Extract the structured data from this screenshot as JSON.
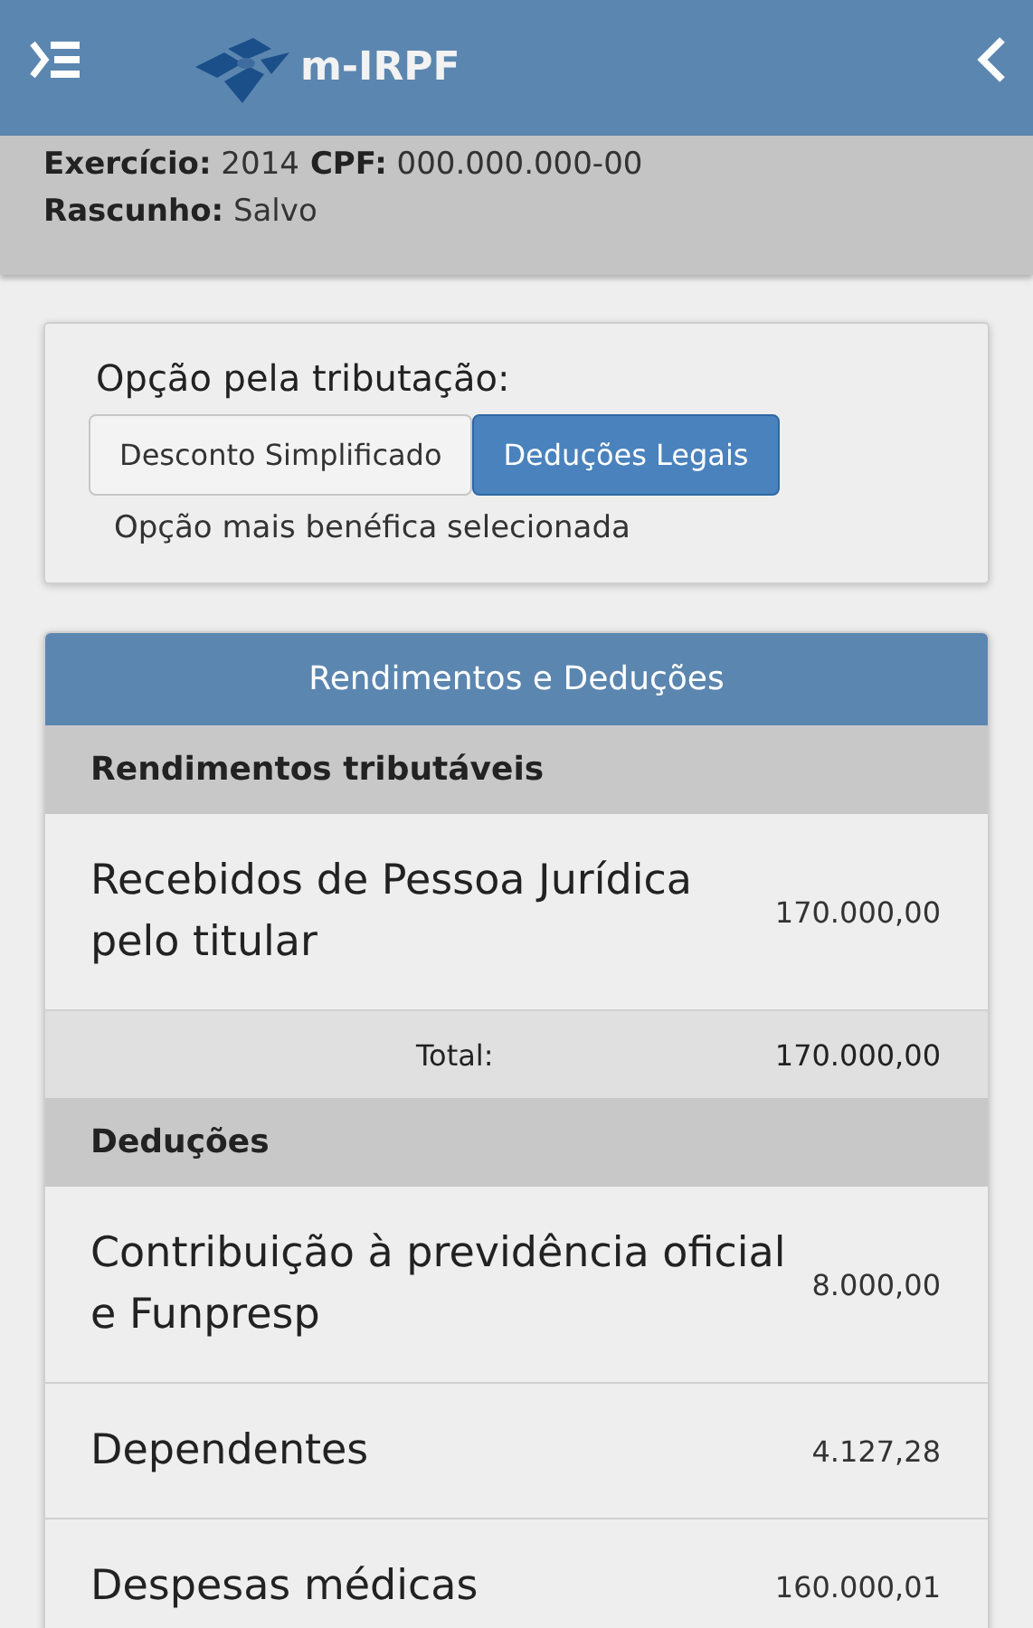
{
  "header": {
    "title": "m-IRPF"
  },
  "info_lines": [
    [
      {
        "label": "Exercício:",
        "value": "2014"
      },
      {
        "label": "CPF:",
        "value": "000.000.000-00"
      }
    ],
    [
      {
        "label": "Rascunho:",
        "value": "Salvo"
      }
    ]
  ],
  "options": {
    "title": "Opção pela tributação:",
    "buttons": [
      {
        "label": "Desconto Simplificado",
        "selected": false
      },
      {
        "label": "Deduções Legais",
        "selected": true
      }
    ],
    "note": "Opção mais benéfica selecionada"
  },
  "table": {
    "title": "Rendimentos e Deduções",
    "sections": [
      {
        "title": "Rendimentos tributáveis",
        "rows": [
          {
            "label": "Recebidos de Pessoa Jurídica pelo titular",
            "value": "170.000,00"
          }
        ],
        "total": {
          "label": "Total:",
          "value": "170.000,00"
        }
      },
      {
        "title": "Deduções",
        "rows": [
          {
            "label": "Contribuição à previdência oficial e Funpresp",
            "value": "8.000,00"
          },
          {
            "label": "Dependentes",
            "value": "4.127,28"
          },
          {
            "label": "Despesas médicas",
            "value": "160.000,01"
          }
        ]
      }
    ]
  }
}
